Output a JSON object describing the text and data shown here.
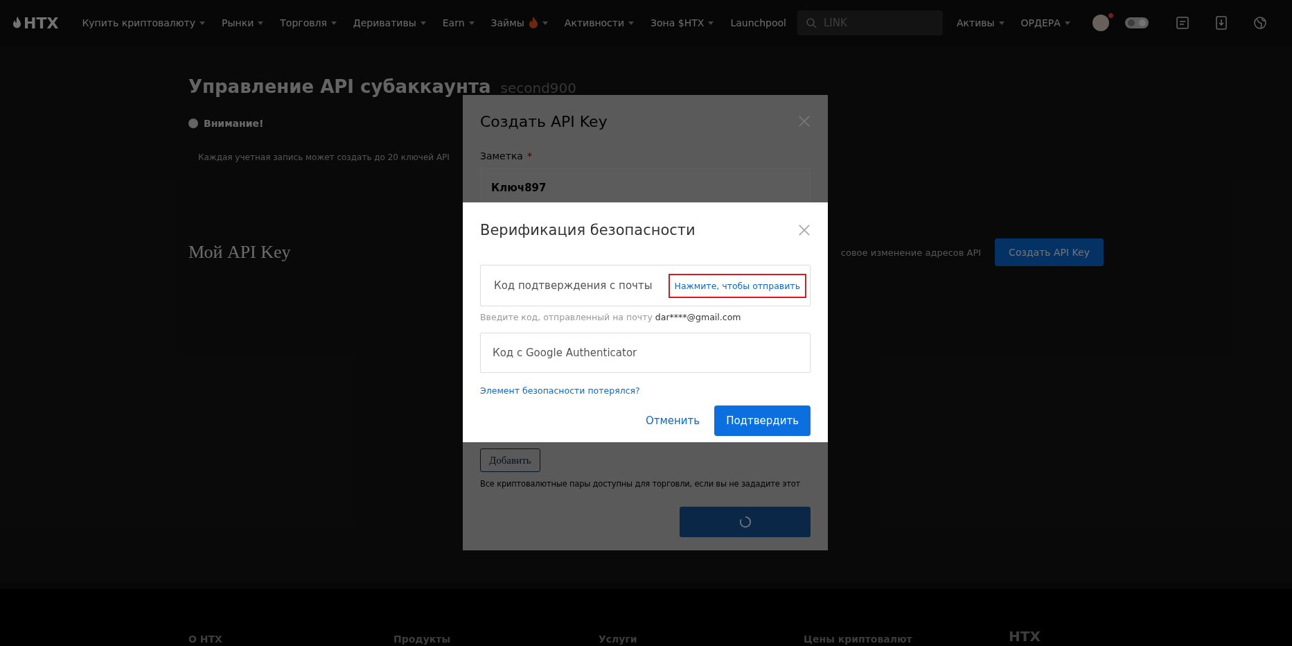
{
  "nav": {
    "logo": "HTX",
    "items": [
      {
        "label": "Купить криптовалюту",
        "dropdown": true,
        "hot": false
      },
      {
        "label": "Рынки",
        "dropdown": true,
        "hot": false
      },
      {
        "label": "Торговля",
        "dropdown": true,
        "hot": false
      },
      {
        "label": "Деривативы",
        "dropdown": true,
        "hot": false
      },
      {
        "label": "Earn",
        "dropdown": true,
        "hot": false
      },
      {
        "label": "Займы",
        "dropdown": true,
        "hot": true
      },
      {
        "label": "Активности",
        "dropdown": true,
        "hot": false
      },
      {
        "label": "Зона $HTX",
        "dropdown": true,
        "hot": false
      },
      {
        "label": "Launchpool",
        "dropdown": false,
        "hot": false
      }
    ],
    "search": {
      "placeholder": "LINK"
    },
    "right_items": [
      {
        "label": "Активы",
        "dropdown": true
      },
      {
        "label": "ОРДЕРА",
        "dropdown": true
      }
    ],
    "avatar_notification": true
  },
  "page": {
    "title": "Управление API субаккаунта",
    "subaccount": "second900",
    "notice_title": "Внимание!",
    "notices": [
      "Каждая учетная запись может создать до 20 ключей API"
    ],
    "section_title": "Мой API Key",
    "section_link": "совое изменение адресов API",
    "create_button": "Создать API Key"
  },
  "create_modal": {
    "title": "Создать API Key",
    "note_label": "Заметка",
    "note_required_mark": "*",
    "note_value": "Ключ897",
    "add_button": "Добавить",
    "hint": "Все криптовалютные пары доступны для торговли, если вы не зададите этот",
    "submit_loading": true
  },
  "verify_modal": {
    "title": "Верификация безопасности",
    "email_field": {
      "placeholder": "Код подтверждения с почты"
    },
    "send_link": {
      "label": "Нажмите, чтобы отправить",
      "highlighted": true
    },
    "email_hint": "Введите код, отправленный на почту",
    "email": "dar****@gmail.com",
    "ga_field": {
      "placeholder": "Код с Google Authenticator"
    },
    "lost_link": "Элемент безопасности потерялся?",
    "cancel": "Отменить",
    "confirm": "Подтвердить"
  },
  "footer": {
    "columns": [
      "О HTX",
      "Продукты",
      "Услуги",
      "Цены криптовалют"
    ],
    "logo": "HTX"
  }
}
